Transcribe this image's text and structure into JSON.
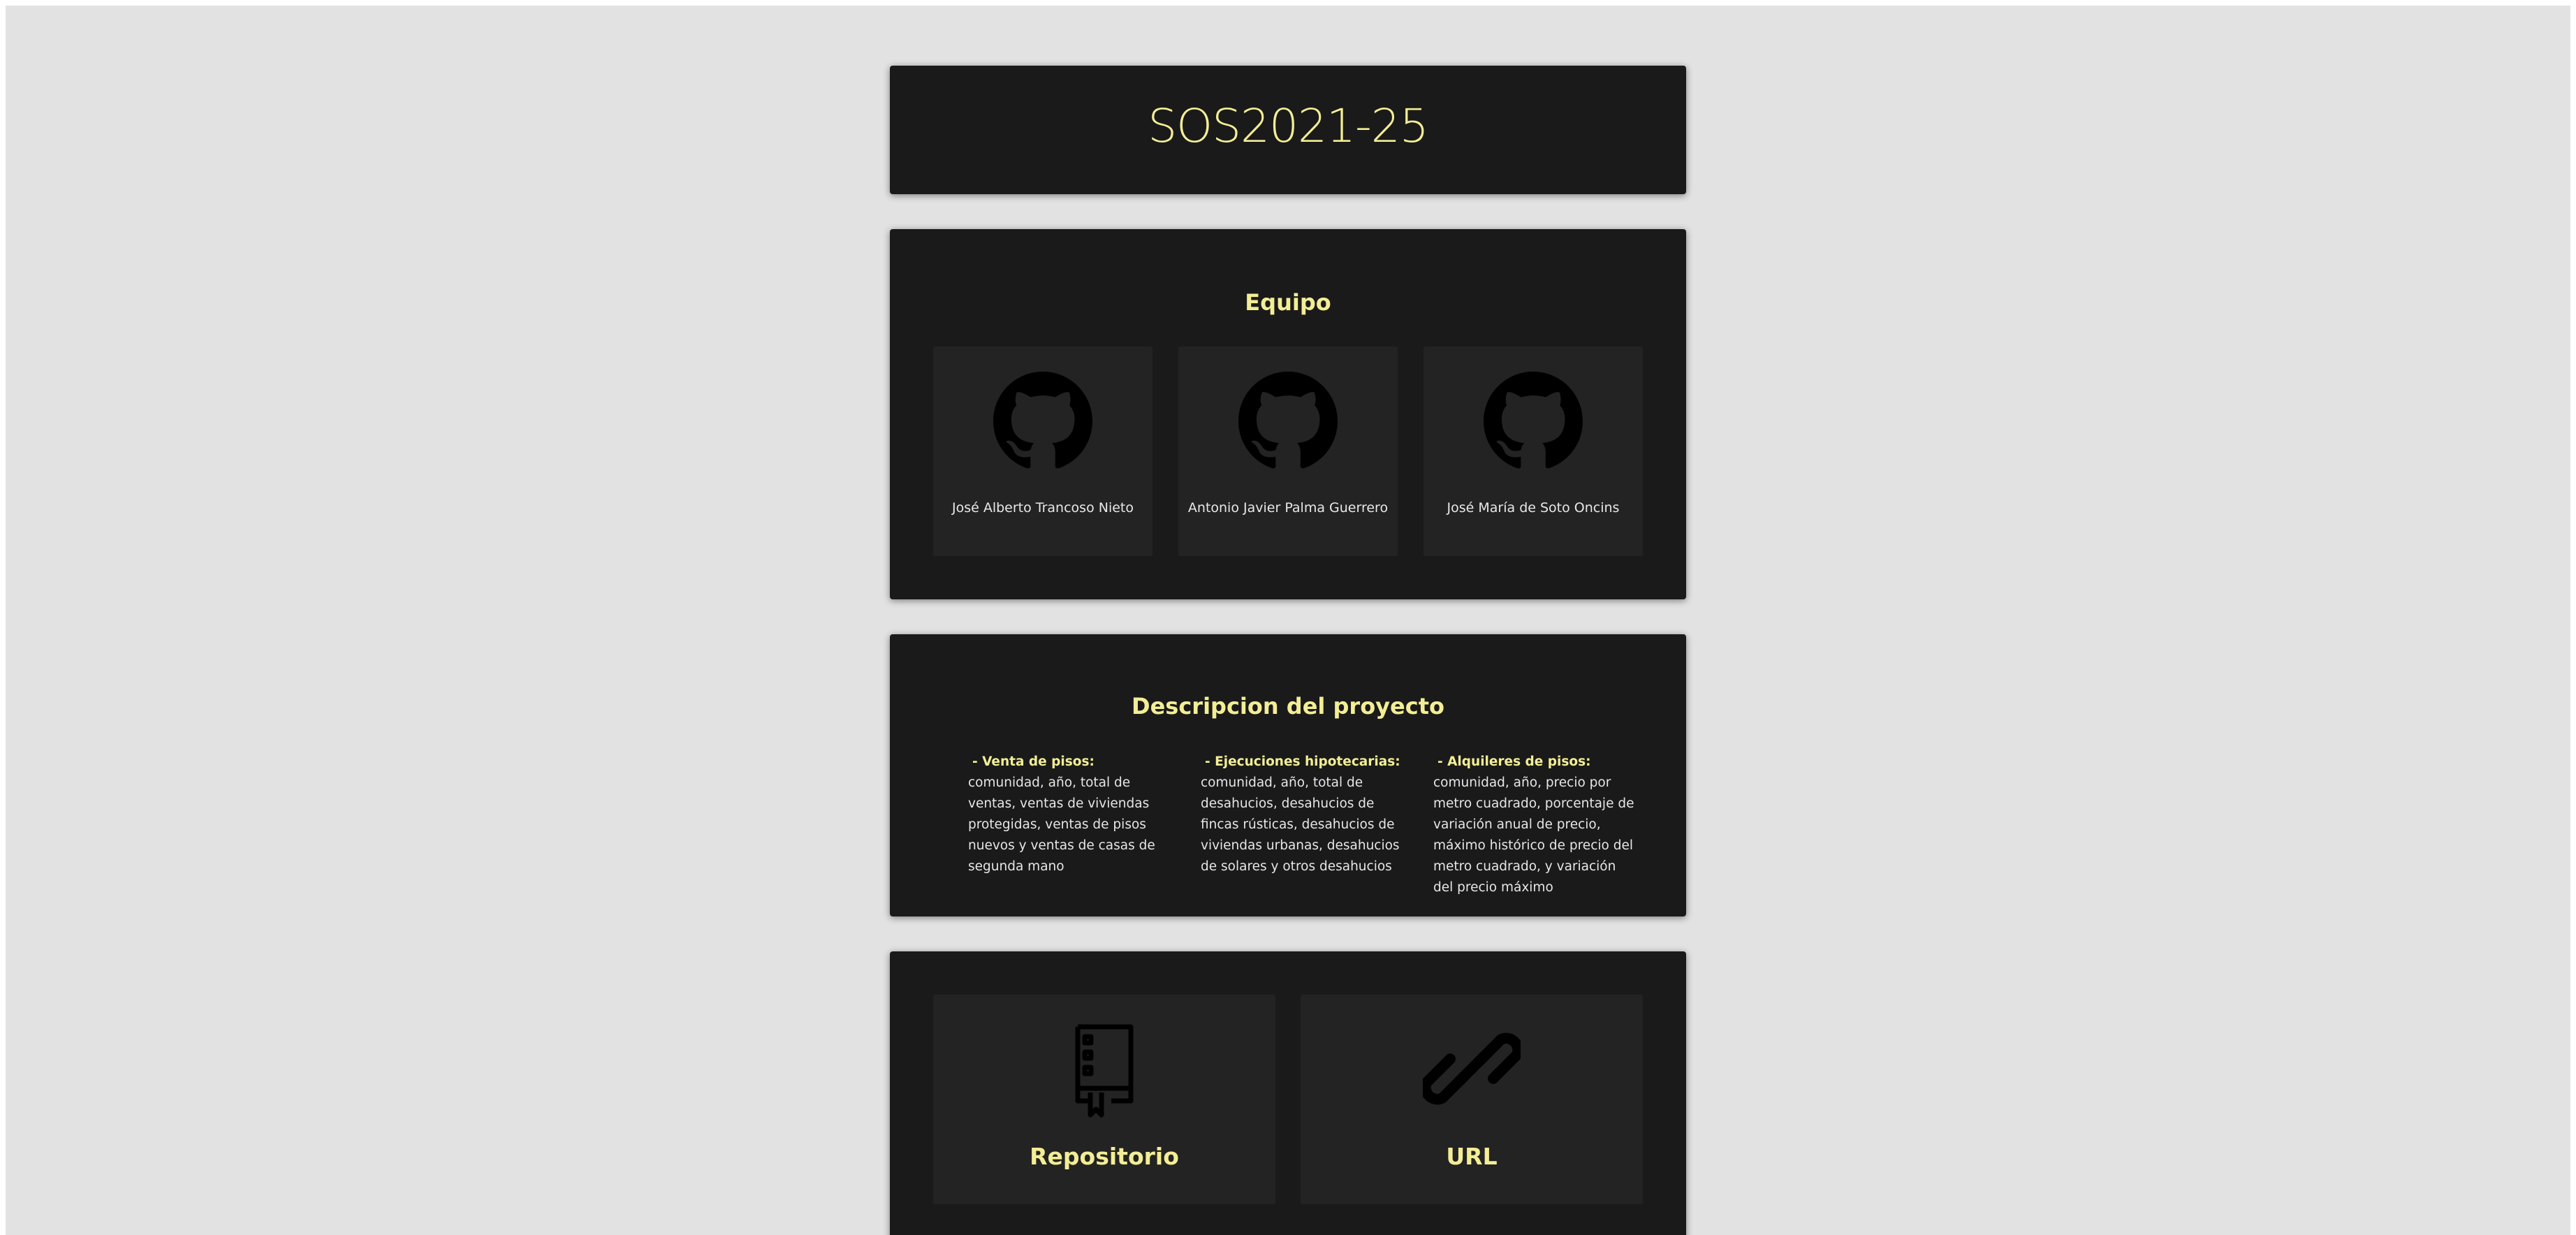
{
  "header": {
    "title": "SOS2021-25"
  },
  "team": {
    "title": "Equipo",
    "members": [
      {
        "name": "José Alberto Trancoso Nieto",
        "icon": "github-icon"
      },
      {
        "name": "Antonio Javier Palma Guerrero",
        "icon": "github-icon"
      },
      {
        "name": "José María de Soto Oncins",
        "icon": "github-icon"
      }
    ]
  },
  "description": {
    "title": "Descripcion del proyecto",
    "items": [
      {
        "heading": "- Venta de pisos:",
        "text": "comunidad, año, total de ventas, ventas de viviendas protegidas, ventas de pisos nuevos y ventas de casas de segunda mano"
      },
      {
        "heading": "- Ejecuciones hipotecarias:",
        "text": "comunidad, año, total de desahucios, desahucios de fincas rústicas, desahucios de viviendas urbanas, desahucios de solares y otros desahucios"
      },
      {
        "heading": "- Alquileres de pisos:",
        "text": "comunidad, año, precio por metro cuadrado, porcentaje de variación anual de precio, máximo histórico de precio del metro cuadrado, y variación del precio máximo"
      }
    ]
  },
  "links": {
    "repo_label": "Repositorio",
    "repo_icon": "repository-icon",
    "url_label": "URL",
    "url_icon": "link-icon"
  },
  "colors": {
    "page_background": "#e2e2e2",
    "card_background": "#1a1a1a",
    "tile_background": "#232323",
    "accent": "#f3ee95"
  }
}
